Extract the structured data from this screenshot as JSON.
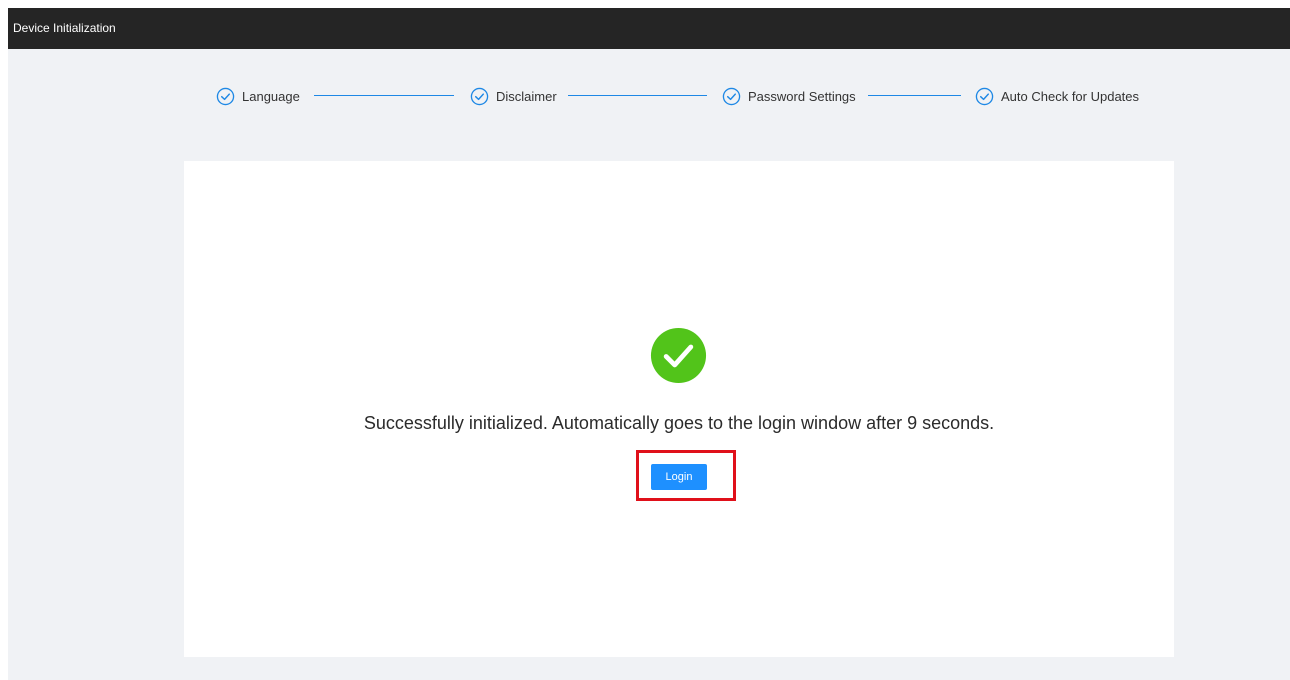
{
  "window": {
    "title": "Device Initialization"
  },
  "steps": [
    {
      "label": "Language",
      "status": "completed",
      "icon": "check-circle-icon"
    },
    {
      "label": "Disclaimer",
      "status": "completed",
      "icon": "check-circle-icon"
    },
    {
      "label": "Password Settings",
      "status": "completed",
      "icon": "check-circle-icon"
    },
    {
      "label": "Auto Check for Updates",
      "status": "completed",
      "icon": "check-circle-icon"
    }
  ],
  "result": {
    "icon": "success-check-icon",
    "message": "Successfully initialized. Automatically goes to the login window after 9 seconds.",
    "login_label": "Login"
  },
  "colors": {
    "titlebar": "#252525",
    "accent": "#1e88e5",
    "success": "#52c41a",
    "button": "#1e90ff",
    "highlight": "#e0101a",
    "background": "#f0f2f5"
  }
}
